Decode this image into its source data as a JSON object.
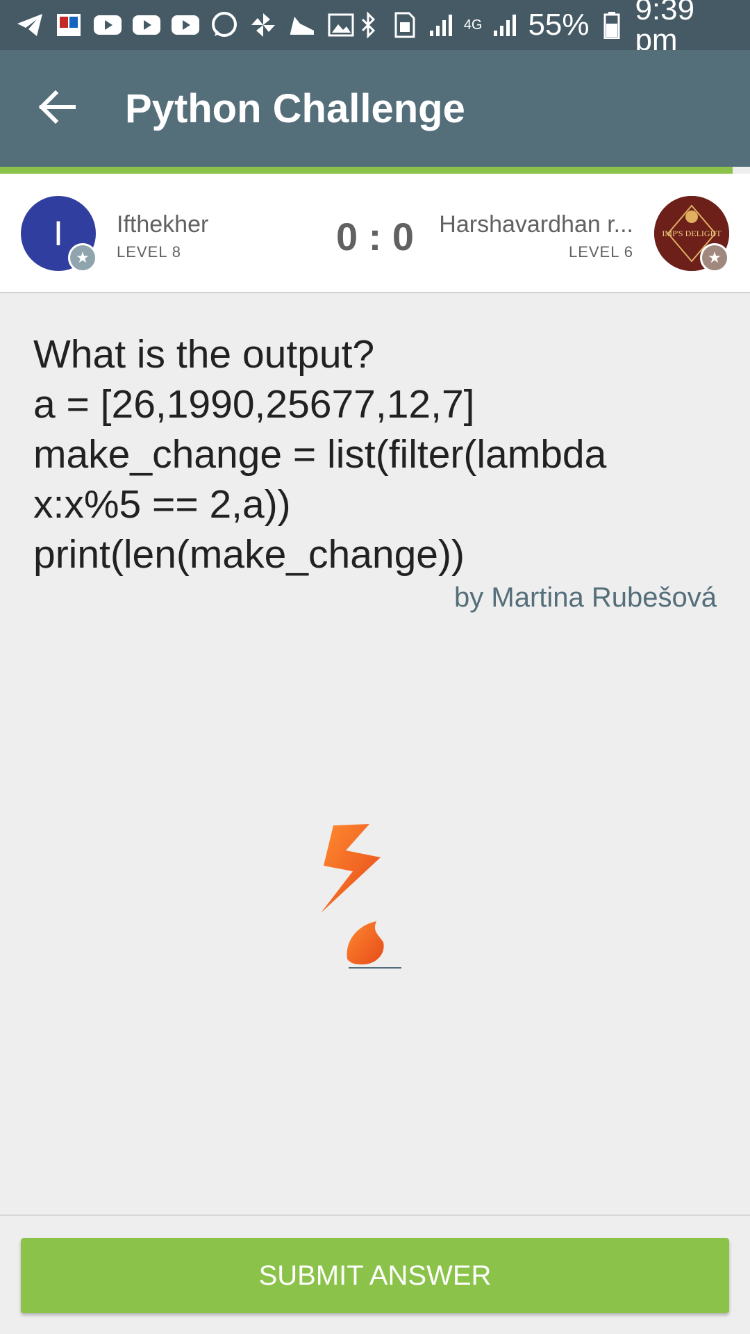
{
  "status_bar": {
    "battery": "55%",
    "time": "9:39 pm",
    "network": "4G",
    "icons": [
      "telegram-icon",
      "app-icon",
      "youtube-icon",
      "youtube-icon",
      "youtube-icon",
      "whatsapp-icon",
      "pinwheel-icon",
      "shoe-icon",
      "image-icon",
      "bluetooth-icon",
      "sim-icon",
      "signal-icon",
      "signal-icon",
      "battery-icon"
    ]
  },
  "app_bar": {
    "title": "Python Challenge"
  },
  "colors": {
    "app_bar": "#546e7a",
    "status_bar": "#455a64",
    "accent": "#8bc34a",
    "author": "#546e7a"
  },
  "players": {
    "left": {
      "initial": "I",
      "name": "Ifthekher",
      "level": "LEVEL 8"
    },
    "right": {
      "name": "Harshavardhan r...",
      "level": "LEVEL 6",
      "avatar_text": "IMP'S DELIGHT"
    },
    "score": "0 : 0"
  },
  "question": {
    "lines": [
      "What is the output?",
      "a = [26,1990,25677,12,7]",
      "make_change = list(filter(lambda",
      "x:x%5 == 2,a))",
      "print(len(make_change))"
    ],
    "author": "by Martina Rubešová"
  },
  "submit": {
    "label": "SUBMIT ANSWER"
  }
}
